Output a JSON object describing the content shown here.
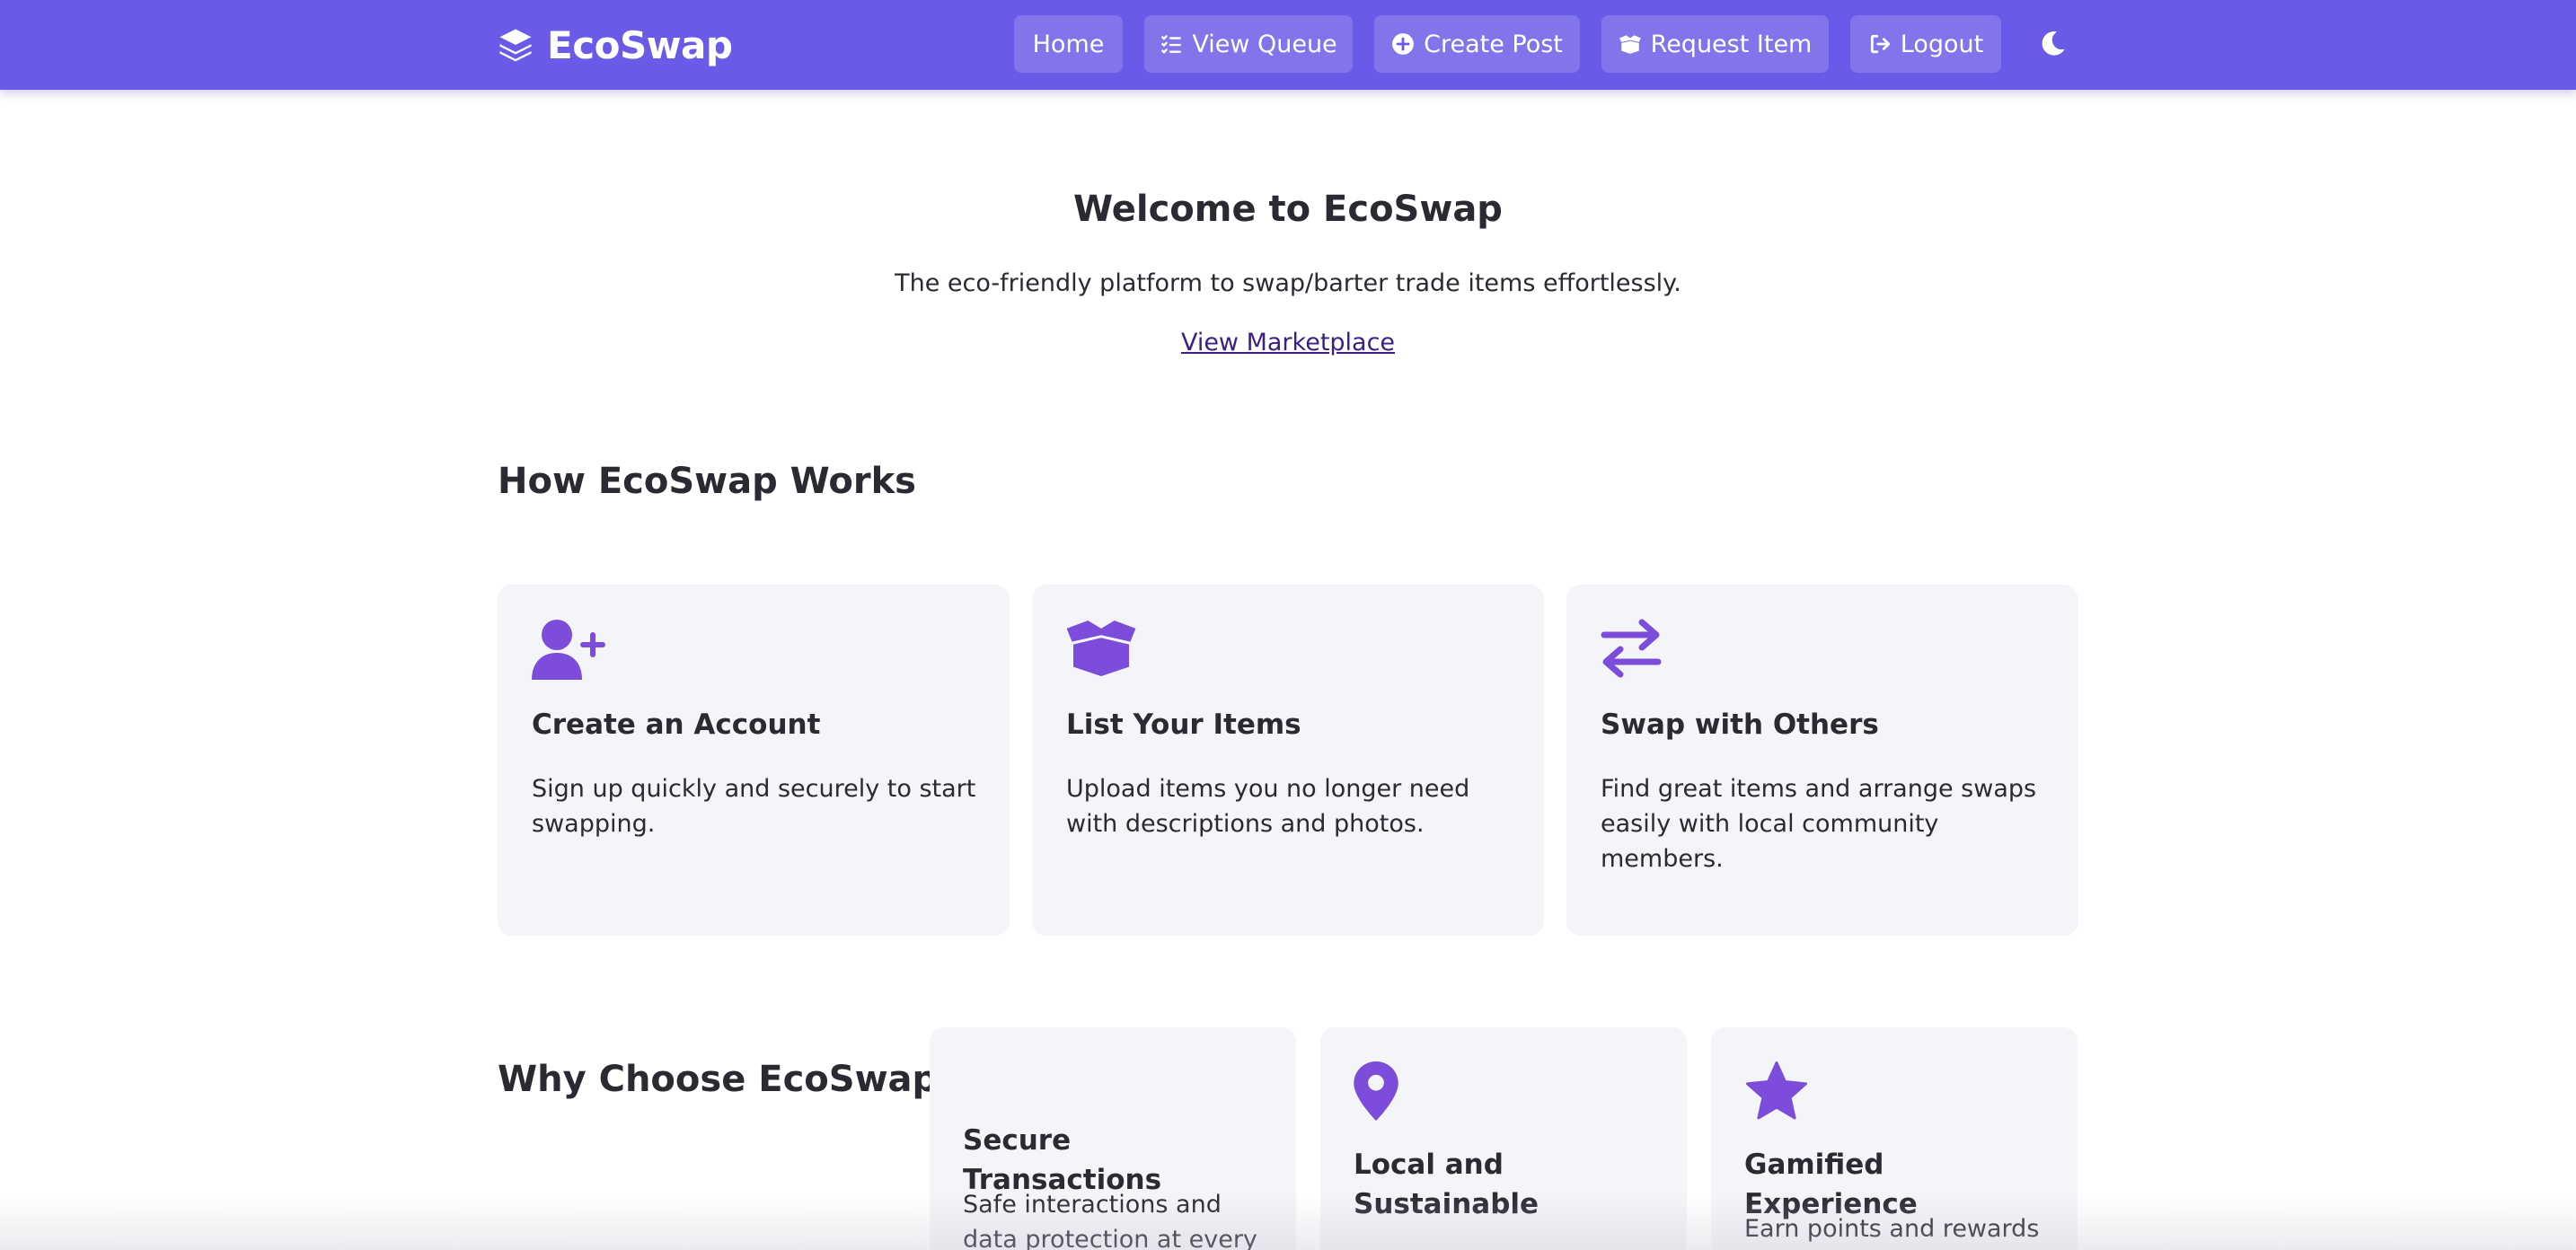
{
  "brand": {
    "name": "EcoSwap",
    "icon": "layers-icon"
  },
  "nav": {
    "home": {
      "label": "Home"
    },
    "view_queue": {
      "label": "View Queue",
      "icon": "list-check-icon"
    },
    "create_post": {
      "label": "Create Post",
      "icon": "plus-circle-icon"
    },
    "request_item": {
      "label": "Request Item",
      "icon": "box-open-icon"
    },
    "logout": {
      "label": "Logout",
      "icon": "logout-icon"
    },
    "theme_toggle": {
      "icon": "moon-icon"
    }
  },
  "hero": {
    "title": "Welcome to EcoSwap",
    "subtitle": "The eco-friendly platform to swap/barter trade items effortlessly.",
    "link": "View Marketplace"
  },
  "how_it_works": {
    "title": "How EcoSwap Works",
    "cards": [
      {
        "icon": "user-plus-icon",
        "title": "Create an Account",
        "description": "Sign up quickly and securely to start swapping."
      },
      {
        "icon": "box-open-icon",
        "title": "List Your Items",
        "description": "Upload items you no longer need with descriptions and photos."
      },
      {
        "icon": "arrows-swap-icon",
        "title": "Swap with Others",
        "description": "Find great items and arrange swaps easily with local community members."
      }
    ]
  },
  "why_choose": {
    "title": "Why Choose EcoSwap?",
    "cards": [
      {
        "icon": "",
        "title": "Secure Transactions",
        "description": "Safe interactions and data protection at every"
      },
      {
        "icon": "map-pin-icon",
        "title": "Local and Sustainable",
        "description": ""
      },
      {
        "icon": "star-icon",
        "title": "Gamified Experience",
        "description": "Earn points and rewards"
      }
    ]
  },
  "colors": {
    "navbar": "#6a5ae8",
    "accent_icon": "#7c4ddb",
    "card_background": "#f4f5f9",
    "link": "#3b1f84",
    "text": "#2a2a33"
  }
}
